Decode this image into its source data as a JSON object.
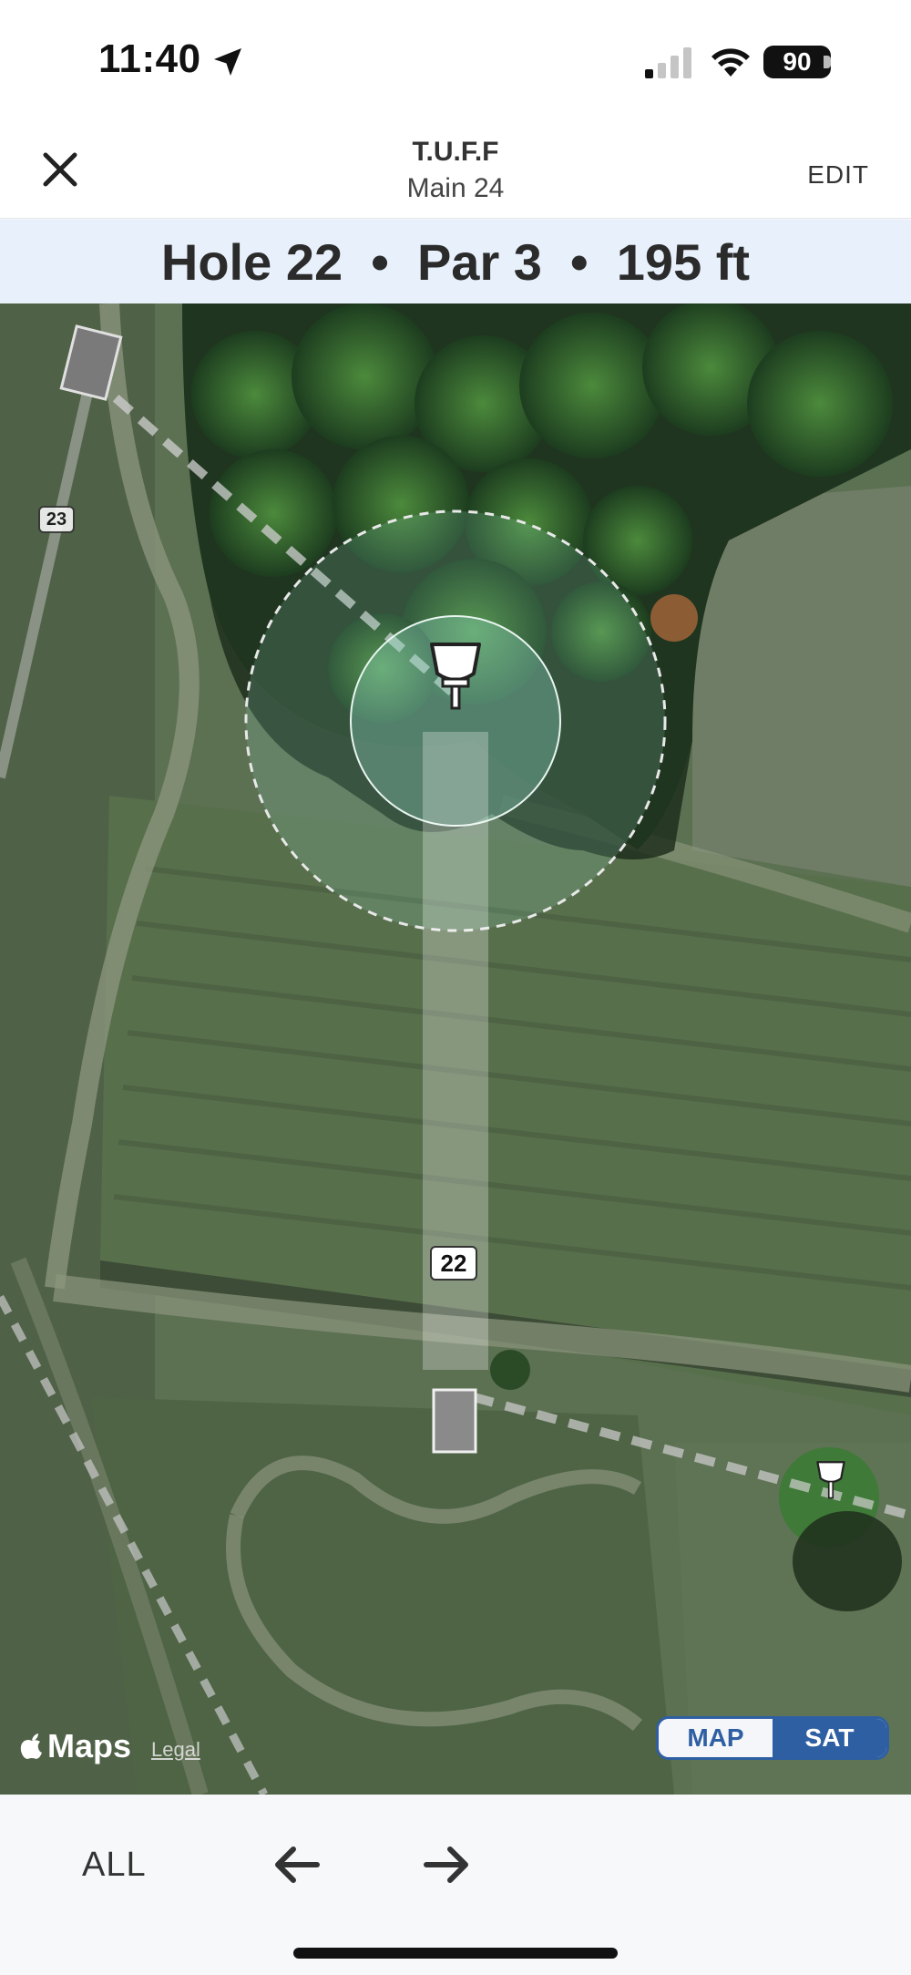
{
  "status_bar": {
    "time": "11:40",
    "battery": "90",
    "icons": [
      "location-arrow-icon",
      "cellular-signal-icon",
      "wifi-icon",
      "battery-icon"
    ]
  },
  "header": {
    "close_icon": "close-icon",
    "title": "T.U.F.F",
    "subtitle": "Main 24",
    "edit_label": "EDIT"
  },
  "hole": {
    "banner": "Hole 22  •  Par 3  •  195 ft"
  },
  "map": {
    "current_hole_label": "22",
    "next_hole_label": "23",
    "attribution": "Maps",
    "legal_label": "Legal",
    "toggle": {
      "options": [
        "MAP",
        "SAT"
      ],
      "selected": "SAT"
    },
    "colors": {
      "accent": "#2f5fa3",
      "fairway": "#ffffff",
      "circle": "#7fd6c0"
    }
  },
  "bottom_nav": {
    "all_label": "ALL",
    "prev_icon": "arrow-left-icon",
    "next_icon": "arrow-right-icon"
  }
}
